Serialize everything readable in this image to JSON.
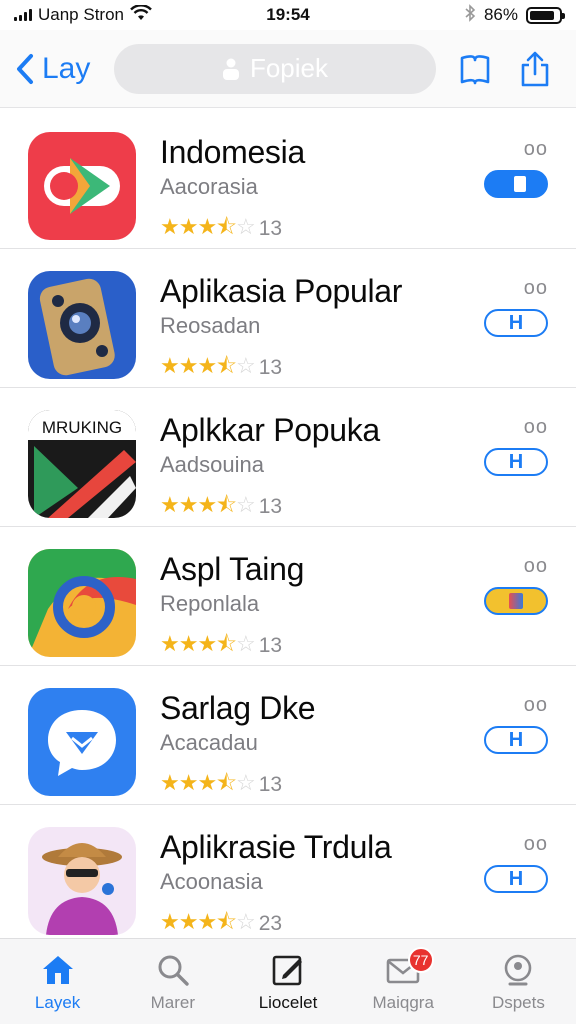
{
  "status_bar": {
    "carrier": "Uanp Stron",
    "time": "19:54",
    "battery": "86%",
    "battery_level": 0.86,
    "icons": [
      "signal-icon",
      "wifi-icon",
      "bluetooth-icon",
      "battery-icon"
    ]
  },
  "nav": {
    "back_label": "Lay",
    "search_placeholder": "Fopiek",
    "icons": [
      "book-icon",
      "share-icon"
    ]
  },
  "apps": [
    {
      "title": "Indomesia",
      "subtitle": "Aacorasia",
      "rating": 3.5,
      "rating_count": "13",
      "more": "oo",
      "action": "",
      "action_style": "on"
    },
    {
      "title": "Aplikasia Popular",
      "subtitle": "Reosadan",
      "rating": 3.5,
      "rating_count": "13",
      "more": "oo",
      "action": "H",
      "action_style": "outline"
    },
    {
      "title": "Aplkkar Popuka",
      "subtitle": "Aadsouina",
      "rating": 3.5,
      "rating_count": "13",
      "more": "oo",
      "action": "H",
      "action_style": "outline",
      "icon_text": "MRUKING"
    },
    {
      "title": "Aspl Taing",
      "subtitle": "Reponlala",
      "rating": 3.5,
      "rating_count": "13",
      "more": "oo",
      "action": "",
      "action_style": "yellow"
    },
    {
      "title": "Sarlag Dke",
      "subtitle": "Acacadau",
      "rating": 3.5,
      "rating_count": "13",
      "more": "oo",
      "action": "H",
      "action_style": "outline"
    },
    {
      "title": "Aplikrasie Trdula",
      "subtitle": "Acoonasia",
      "rating": 3.5,
      "rating_count": "23",
      "more": "oo",
      "action": "H",
      "action_style": "outline"
    }
  ],
  "tabs": [
    {
      "label": "Layek",
      "icon": "home-icon",
      "active": true
    },
    {
      "label": "Marer",
      "icon": "search-icon",
      "active": false
    },
    {
      "label": "Liocelet",
      "icon": "edit-icon",
      "active": false
    },
    {
      "label": "Maiqgra",
      "icon": "mail-icon",
      "active": false,
      "badge": "77"
    },
    {
      "label": "Dspets",
      "icon": "account-icon",
      "active": false
    }
  ],
  "colors": {
    "accent": "#1c7cf4",
    "star": "#f4b41a",
    "badge": "#e8322f"
  }
}
